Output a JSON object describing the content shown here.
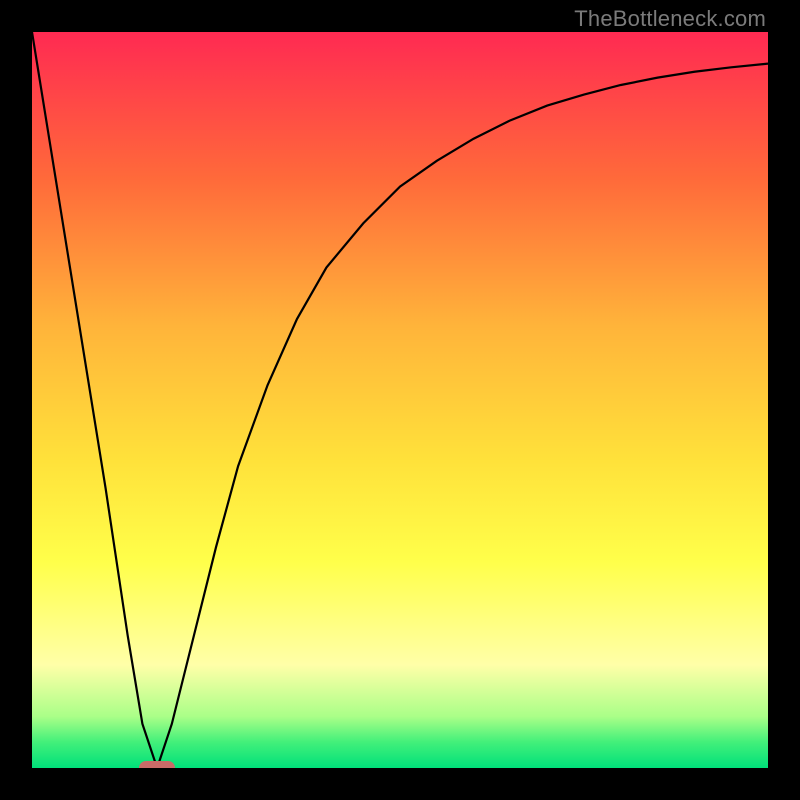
{
  "watermark": "TheBottleneck.com",
  "colors": {
    "bg_black": "#000000",
    "grad_top": "#ff2a52",
    "grad_mid1": "#ff6a3a",
    "grad_mid2": "#ffb43a",
    "grad_mid3": "#ffe13a",
    "grad_mid4": "#ffff4a",
    "grad_pale": "#ffffa8",
    "grad_green1": "#aaff88",
    "grad_green2": "#42f07a",
    "grad_green3": "#00e07a",
    "marker_fill": "#c96b68",
    "curve": "#000000"
  },
  "chart_data": {
    "type": "line",
    "title": "",
    "xlabel": "",
    "ylabel": "",
    "xlim": [
      0,
      100
    ],
    "ylim": [
      0,
      100
    ],
    "series": [
      {
        "name": "bottleneck-curve",
        "comment": "V-shaped curve; left linear descent to min, right side asymptotic rise",
        "x": [
          0,
          5,
          10,
          13,
          15,
          17,
          19,
          20,
          22,
          25,
          28,
          32,
          36,
          40,
          45,
          50,
          55,
          60,
          65,
          70,
          75,
          80,
          85,
          90,
          95,
          100
        ],
        "y": [
          100,
          69,
          38,
          18,
          6,
          0,
          6,
          10,
          18,
          30,
          41,
          52,
          61,
          68,
          74,
          79,
          82.5,
          85.5,
          88,
          90,
          91.5,
          92.8,
          93.8,
          94.6,
          95.2,
          95.7
        ]
      }
    ],
    "marker": {
      "x": 17,
      "y": 0
    },
    "gradient_stops": [
      {
        "pct": 0,
        "key": "grad_top"
      },
      {
        "pct": 20,
        "key": "grad_mid1"
      },
      {
        "pct": 40,
        "key": "grad_mid2"
      },
      {
        "pct": 58,
        "key": "grad_mid3"
      },
      {
        "pct": 72,
        "key": "grad_mid4"
      },
      {
        "pct": 86,
        "key": "grad_pale"
      },
      {
        "pct": 93,
        "key": "grad_green1"
      },
      {
        "pct": 96.5,
        "key": "grad_green2"
      },
      {
        "pct": 100,
        "key": "grad_green3"
      }
    ]
  }
}
